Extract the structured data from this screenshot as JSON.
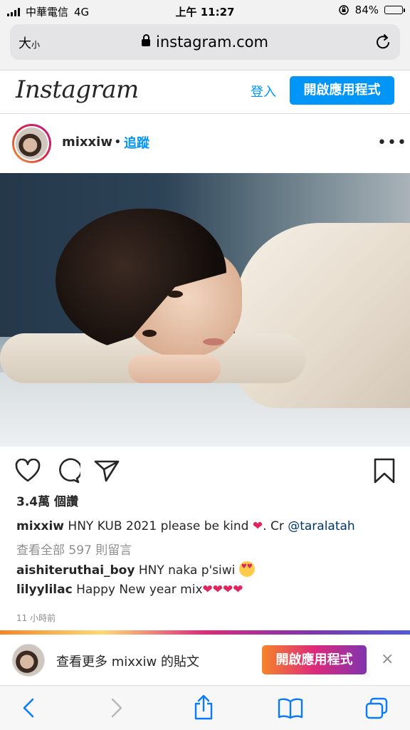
{
  "status": {
    "carrier": "中華電信",
    "network": "4G",
    "time": "上午 11:27",
    "battery": "84%",
    "battery_level": 0.84
  },
  "browser": {
    "text_size_label": "大",
    "text_size_small": "小",
    "domain": "instagram.com"
  },
  "header": {
    "logo": "Instagram",
    "login_label": "登入",
    "open_app_label": "開啟應用程式"
  },
  "post": {
    "username": "mixxiw",
    "separator": "•",
    "follow_label": "追蹤",
    "more_label": "•••",
    "likes": "3.4萬 個讚",
    "caption_user": "mixxiw",
    "caption_text": "HNY KUB 2021 please be kind",
    "caption_suffix": ". Cr",
    "caption_mention": "@taralatah",
    "view_all_comments": "查看全部 597 則留言",
    "comments": [
      {
        "user": "aishiteruthai_boy",
        "text": "HNY naka p'siwi"
      },
      {
        "user": "lilyylilac",
        "text": "Happy New year mix"
      }
    ],
    "time_ago": "11 小時前"
  },
  "banner": {
    "text": "查看更多 mixxiw 的貼文",
    "button_label": "開啟應用程式",
    "close": "×"
  },
  "colors": {
    "accent": "#0095f6",
    "heart": "#e0245e"
  }
}
